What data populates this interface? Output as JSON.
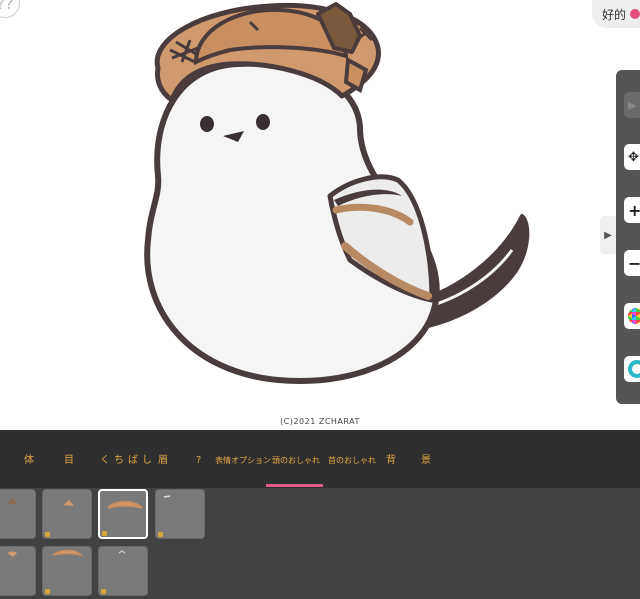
{
  "top": {
    "help_label": "??",
    "favorite_label": "好的"
  },
  "canvas": {
    "copyright": "(C)2021 ZCHARAT"
  },
  "category_tabs": [
    {
      "label": "体"
    },
    {
      "label": "目"
    },
    {
      "label": "くちばし"
    },
    {
      "label": "眉"
    },
    {
      "label": "?"
    },
    {
      "label": "表情オプション"
    },
    {
      "label": "頭のおしゃれ",
      "selected": true
    },
    {
      "label": "首のおしゃれ"
    },
    {
      "label": "背"
    },
    {
      "label": "景"
    }
  ],
  "toolbar": {
    "tools": [
      {
        "icon": "play-icon"
      },
      {
        "icon": "move-icon",
        "glyph": "✥"
      },
      {
        "icon": "zoom-in-icon",
        "glyph": "+"
      },
      {
        "icon": "zoom-out-icon",
        "glyph": "−"
      },
      {
        "icon": "color-wheel-icon"
      },
      {
        "icon": "color-ring-icon"
      }
    ]
  },
  "parts": {
    "selected_index": 2,
    "count": 7
  },
  "colors": {
    "accent": "#e25b86",
    "tab_text": "#e3a545",
    "panel_bg": "#424242",
    "tab_bar_bg": "#2f2f2f",
    "hat": "#d19a6e",
    "bird_outline": "#4a3b3c"
  }
}
